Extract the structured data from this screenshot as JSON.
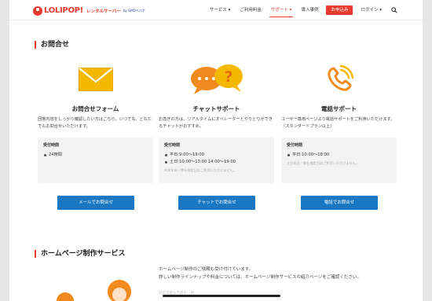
{
  "header": {
    "logo_text": "LOLIPOP!",
    "logo_sub": "レンタルサーバー",
    "logo_by": "by GMOペパボ",
    "nav": [
      {
        "label": "サービス",
        "caret": "▾",
        "active": false
      },
      {
        "label": "ご利用料金",
        "caret": "",
        "active": false
      },
      {
        "label": "サポート",
        "caret": "▾",
        "active": true
      },
      {
        "label": "導入事例",
        "caret": "",
        "active": false
      }
    ],
    "apply_label": "お申込み",
    "login_label": "ログイン",
    "login_caret": "▾",
    "search_icon": "search-icon",
    "accent": "#e63c2f"
  },
  "contact": {
    "section_title": "お問合せ",
    "cards": [
      {
        "icon": "envelope-icon",
        "title": "お問合せフォーム",
        "desc": "回答内容をしっかり確認したい方はこちら。いつでも、どなたでもお問合せいただけます。",
        "hours_label": "受付時間",
        "hours": [
          "24時間"
        ],
        "note": "",
        "button": "メールでお問合せ"
      },
      {
        "icon": "chat-bubbles-icon",
        "title": "チャットサポート",
        "desc": "お急ぎの方は、リアルタイムにオペレーターとやりとりができるチャットがおすすめ。",
        "hours_label": "受付時間",
        "hours": [
          "平日:9:00〜19:00",
          "土日:10:00〜13:00 14:00〜19:00"
        ],
        "note": "年末年始・弊社指定日はご利用いただけません。",
        "button": "チャットでお問合せ"
      },
      {
        "icon": "phone-icon",
        "title": "電話サポート",
        "desc": "ユーザー専用ページより電話サポートをご利用いただけます。（スタンダードプラン以上）",
        "hours_label": "受付時間",
        "hours": [
          "平日:10:00〜18:00"
        ],
        "note": "土日祝日・弊社指定日はご利用いただけません。",
        "button": "電話でお問合せ"
      }
    ],
    "button_color": "#1a78c2"
  },
  "web_service": {
    "section_title": "ホームページ制作サービス",
    "lines": [
      "ホームページ制作のご依頼も受け付けています。",
      "詳しい制作ラインナップや料金については、ホームページ制作サービスの紹介ページをご確認ください。"
    ],
    "faded": "対応可能な内容の一例"
  }
}
